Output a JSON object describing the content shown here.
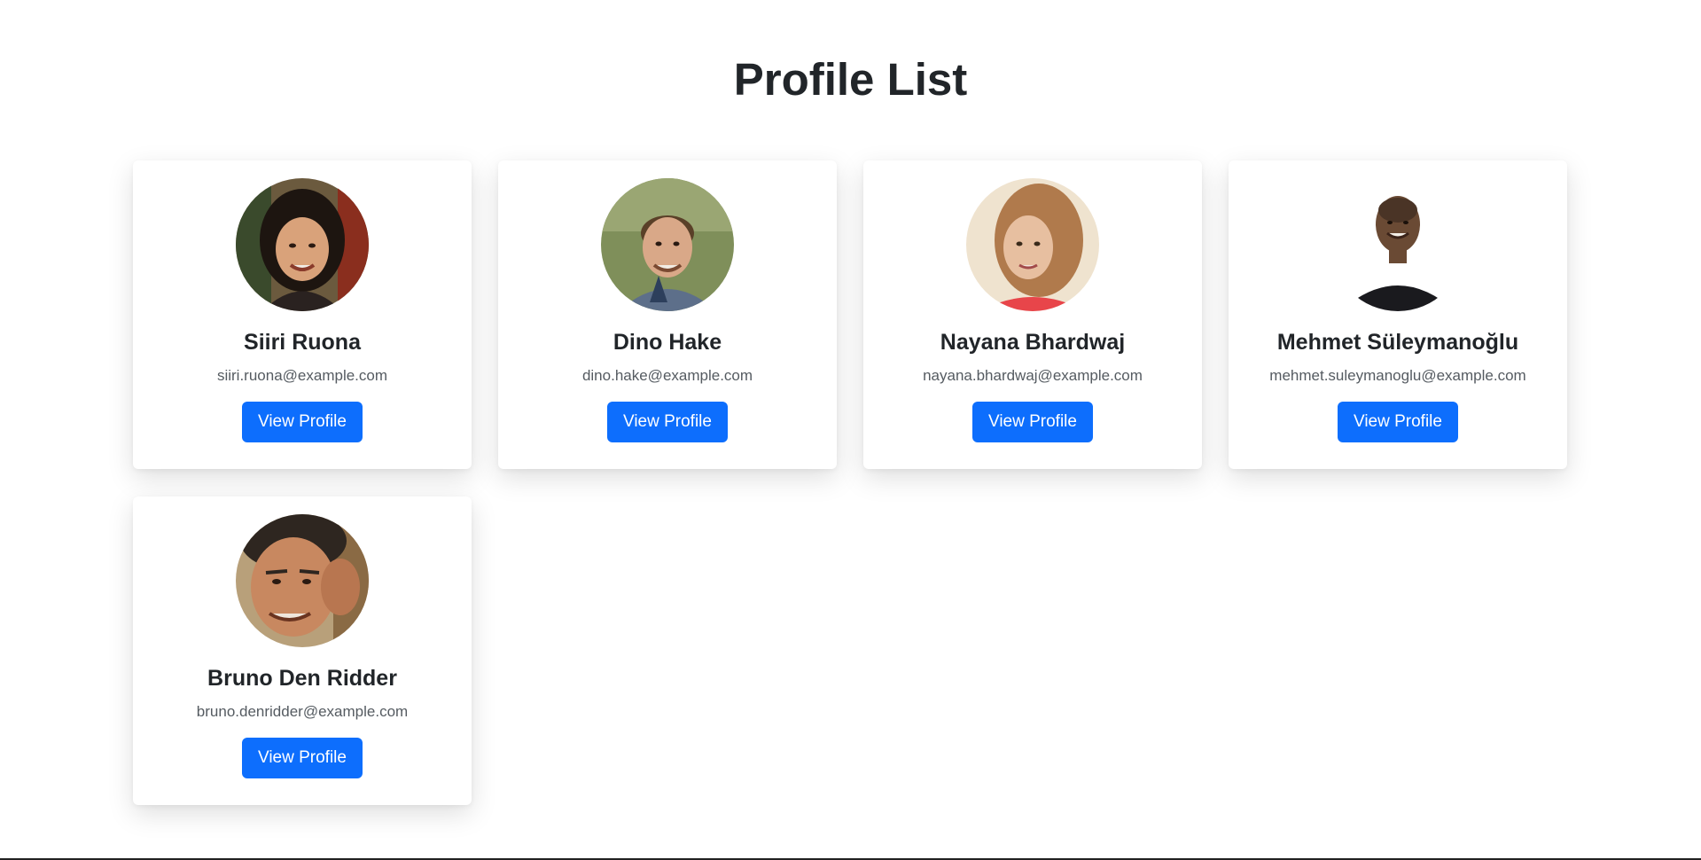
{
  "page": {
    "title": "Profile List"
  },
  "colors": {
    "accent": "#0d6efd",
    "text": "#212529",
    "muted": "#555b61",
    "background": "#ffffff"
  },
  "profiles": [
    {
      "name": "Siiri Ruona",
      "email": "siiri.ruona@example.com",
      "button_label": "View Profile",
      "avatar_icon": "avatar-photo-woman-dark-hair"
    },
    {
      "name": "Dino Hake",
      "email": "dino.hake@example.com",
      "button_label": "View Profile",
      "avatar_icon": "avatar-photo-man-outdoors"
    },
    {
      "name": "Nayana Bhardwaj",
      "email": "nayana.bhardwaj@example.com",
      "button_label": "View Profile",
      "avatar_icon": "avatar-photo-woman-blonde"
    },
    {
      "name": "Mehmet Süleymanoğlu",
      "email": "mehmet.suleymanoglu@example.com",
      "button_label": "View Profile",
      "avatar_icon": "avatar-photo-man-bald"
    },
    {
      "name": "Bruno Den Ridder",
      "email": "bruno.denridder@example.com",
      "button_label": "View Profile",
      "avatar_icon": "avatar-photo-man-closeup"
    }
  ]
}
